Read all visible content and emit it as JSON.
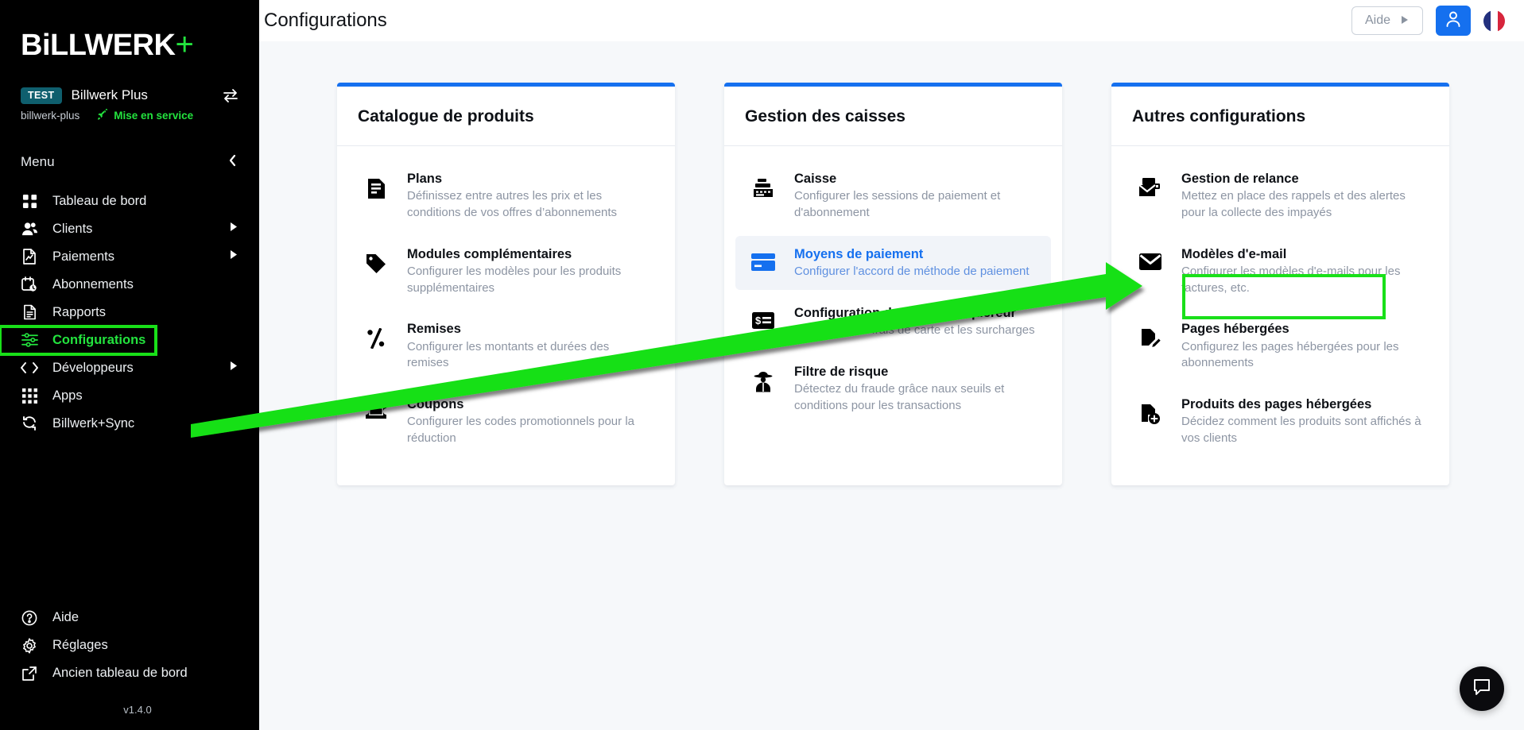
{
  "sidebar": {
    "logo": {
      "text_main": "BiLLWERK",
      "plus": "+"
    },
    "tenant": {
      "badge": "TEST",
      "name": "Billwerk Plus",
      "slug": "billwerk-plus",
      "go_live_label": "Mise en service"
    },
    "menu_label": "Menu",
    "items": [
      {
        "label": "Tableau de bord",
        "icon": "grid-icon",
        "has_caret": false,
        "active": false
      },
      {
        "label": "Clients",
        "icon": "users-icon",
        "has_caret": true,
        "active": false
      },
      {
        "label": "Paiements",
        "icon": "invoice-icon",
        "has_caret": true,
        "active": false
      },
      {
        "label": "Abonnements",
        "icon": "calendar-clock-icon",
        "has_caret": false,
        "active": false
      },
      {
        "label": "Rapports",
        "icon": "document-icon",
        "has_caret": false,
        "active": false
      },
      {
        "label": "Configurations",
        "icon": "sliders-icon",
        "has_caret": false,
        "active": true
      },
      {
        "label": "Développeurs",
        "icon": "code-icon",
        "has_caret": true,
        "active": false
      },
      {
        "label": "Apps",
        "icon": "apps-grid-icon",
        "has_caret": false,
        "active": false
      },
      {
        "label": "Billwerk+Sync",
        "icon": "sync-icon",
        "has_caret": false,
        "active": false
      }
    ],
    "bottom_items": [
      {
        "label": "Aide",
        "icon": "question-circle-icon"
      },
      {
        "label": "Réglages",
        "icon": "gear-icon"
      },
      {
        "label": "Ancien tableau de bord",
        "icon": "external-link-icon"
      }
    ],
    "version": "v1.4.0"
  },
  "header": {
    "title": "Configurations",
    "help_button": "Aide",
    "help_caret": "▶",
    "user_icon": "user-icon",
    "language_flag": "fr-flag"
  },
  "cards": [
    {
      "title": "Catalogue de produits",
      "items": [
        {
          "icon": "plan-document-icon",
          "title": "Plans",
          "desc": "Définissez entre autres les prix et les conditions de vos offres d’abonnements",
          "state": "normal"
        },
        {
          "icon": "tag-icon",
          "title": "Modules complémentaires",
          "desc": "Configurer les modèles pour les produits supplémentaires",
          "state": "normal"
        },
        {
          "icon": "percent-icon",
          "title": "Remises",
          "desc": "Configurer les montants et durées des remises",
          "state": "normal"
        },
        {
          "icon": "coupon-ticket-icon",
          "title": "Coupons",
          "desc": "Configurer les codes promotionnels pour la réduction",
          "state": "normal"
        }
      ]
    },
    {
      "title": "Gestion des caisses",
      "items": [
        {
          "icon": "cash-register-icon",
          "title": "Caisse",
          "desc": "Configurer les sessions de paiement et d'abonnement",
          "state": "normal"
        },
        {
          "icon": "credit-card-icon",
          "title": "Moyens de paiement",
          "desc": "Configurer l'accord de méthode de paiement",
          "state": "selected"
        },
        {
          "icon": "fee-card-icon",
          "title": "Configuration des frais d'acquéreur",
          "desc": "Configurer les frais de carte et les surcharges",
          "state": "normal"
        },
        {
          "icon": "detective-icon",
          "title": "Filtre de risque",
          "desc": "Détectez du fraude grâce naux seuils et conditions pour les transactions",
          "state": "normal"
        }
      ]
    },
    {
      "title": "Autres configurations",
      "items": [
        {
          "icon": "dunning-mail-icon",
          "title": "Gestion de relance",
          "desc": "Mettez en place des rappels et des alertes pour la collecte des impayés",
          "state": "normal"
        },
        {
          "icon": "envelope-icon",
          "title": "Modèles d'e-mail",
          "desc": "Configurer les modèles d'e-mails pour les factures, etc.",
          "state": "highlighted"
        },
        {
          "icon": "page-edit-icon",
          "title": "Pages hébergées",
          "desc": "Configurez les pages hébergées pour les abonnements",
          "state": "normal"
        },
        {
          "icon": "page-plus-icon",
          "title": "Produits des pages hébergées",
          "desc": "Décidez comment les produits sont affichés à vos clients",
          "state": "normal"
        }
      ]
    }
  ],
  "annotation": {
    "arrow_color": "#19e019",
    "highlight_color": "#19e019",
    "arrow_from": "Configurations",
    "arrow_to": "Modèles d'e-mail"
  },
  "chat": {
    "icon": "chat-bubble-icon"
  },
  "colors": {
    "accent_blue": "#1570ef",
    "brand_green": "#23e33e",
    "sidebar_bg": "#000000",
    "page_bg": "#f6f8fa"
  }
}
